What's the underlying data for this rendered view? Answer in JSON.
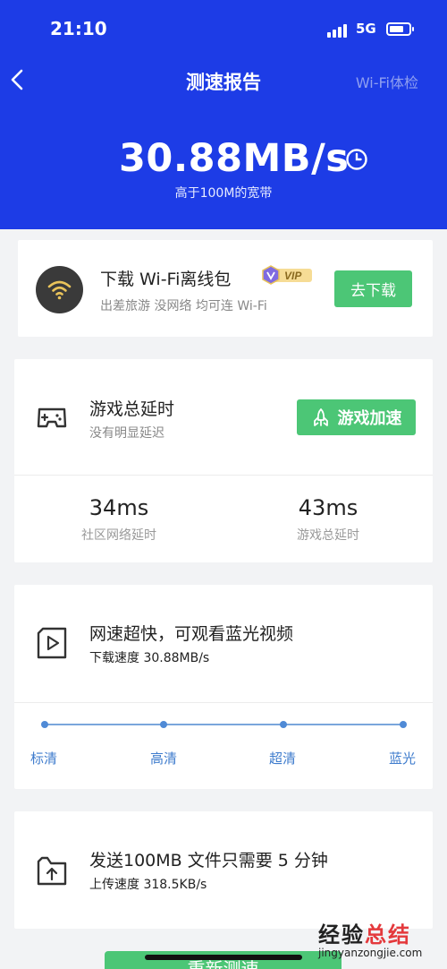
{
  "status": {
    "time": "21:10",
    "network": "5G"
  },
  "header": {
    "title": "测速报告",
    "right_link": "Wi-Fi体检",
    "speed": "30.88MB/s",
    "speed_desc": "高于100M的宽带"
  },
  "offline": {
    "title": "下载 Wi-Fi离线包",
    "badge": "VIP",
    "subtitle": "出差旅游 没网络 均可连 Wi-Fi",
    "button": "去下载"
  },
  "game": {
    "title": "游戏总延时",
    "subtitle": "没有明显延迟",
    "button": "游戏加速",
    "stats": [
      {
        "value": "34ms",
        "label": "社区网络延时"
      },
      {
        "value": "43ms",
        "label": "游戏总延时"
      }
    ]
  },
  "video": {
    "title": "网速超快，可观看蓝光视频",
    "subtitle": "下载速度 30.88MB/s",
    "qualities": [
      "标清",
      "高清",
      "超清",
      "蓝光"
    ]
  },
  "upload": {
    "title": "发送100MB 文件只需要 5 分钟",
    "subtitle": "上传速度 318.5KB/s"
  },
  "retest_button": "重新测速",
  "watermark": {
    "top_black": "经验",
    "top_red": "总结",
    "bottom": "jingyanzongjie.com"
  },
  "colors": {
    "header_bg": "#1d3ce6",
    "accent_green": "#4cc676",
    "quality_blue": "#3f7ccd",
    "page_bg": "#f2f3f5"
  }
}
